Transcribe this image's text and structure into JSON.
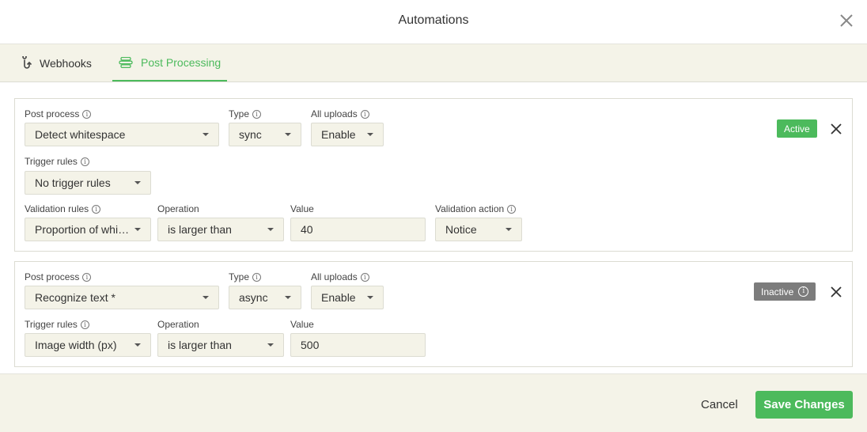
{
  "dialog": {
    "title": "Automations"
  },
  "tabs": [
    {
      "label": "Webhooks",
      "icon": "webhook-icon"
    },
    {
      "label": "Post Processing",
      "icon": "layers-icon",
      "active": true
    }
  ],
  "colors": {
    "accent": "#4cba5c",
    "panel_bg": "#f4f3e8",
    "inactive": "#7c7c7c"
  },
  "rules": [
    {
      "labels": {
        "post_process": "Post process",
        "type": "Type",
        "all_uploads": "All uploads",
        "trigger_rules": "Trigger rules",
        "validation_rules": "Validation rules",
        "operation": "Operation",
        "value": "Value",
        "validation_action": "Validation action"
      },
      "post_process": "Detect whitespace",
      "type": "sync",
      "all_uploads": "Enable",
      "trigger_rules": "No trigger rules",
      "validation_rule": "Proportion of whitespace",
      "operation": "is larger than",
      "value": "40",
      "validation_action": "Notice",
      "status": "Active"
    },
    {
      "labels": {
        "post_process": "Post process",
        "type": "Type",
        "all_uploads": "All uploads",
        "trigger_rules": "Trigger rules",
        "operation": "Operation",
        "value": "Value"
      },
      "post_process": "Recognize text *",
      "type": "async",
      "all_uploads": "Enable",
      "trigger_rule": "Image width (px)",
      "operation": "is larger than",
      "value": "500",
      "status": "Inactive"
    }
  ],
  "footer": {
    "cancel": "Cancel",
    "save": "Save Changes"
  }
}
